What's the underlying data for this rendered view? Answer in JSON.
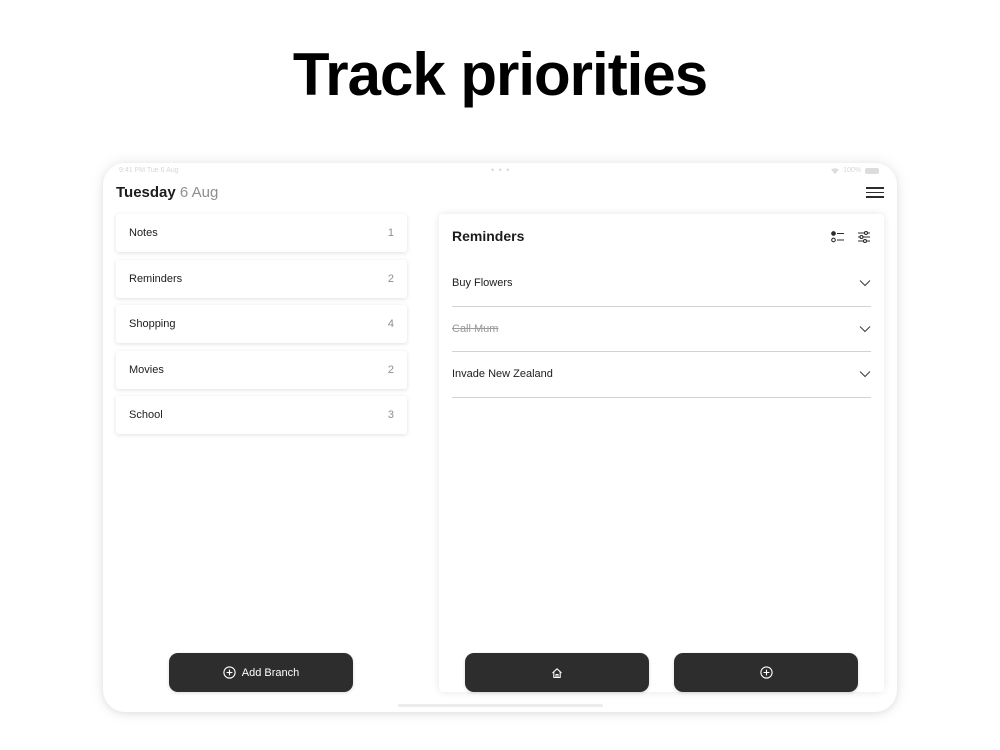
{
  "headline": "Track priorities",
  "status_bar": {
    "time": "9:41 PM  Tue 6 Aug",
    "dots": "• • •",
    "battery": "100%"
  },
  "header": {
    "day": "Tuesday",
    "date": "6 Aug"
  },
  "branches": [
    {
      "name": "Notes",
      "count": "1"
    },
    {
      "name": "Reminders",
      "count": "2"
    },
    {
      "name": "Shopping",
      "count": "4"
    },
    {
      "name": "Movies",
      "count": "2"
    },
    {
      "name": "School",
      "count": "3"
    }
  ],
  "add_branch_label": "Add Branch",
  "panel": {
    "title": "Reminders",
    "reminders": [
      {
        "text": "Buy Flowers",
        "done": false
      },
      {
        "text": "Call Mum",
        "done": true
      },
      {
        "text": "Invade New Zealand",
        "done": false
      }
    ]
  },
  "icons": {
    "menu": "hamburger-menu-icon",
    "list": "checklist-icon",
    "filter": "sliders-icon",
    "chevron": "chevron-down-icon",
    "home": "home-icon",
    "plus": "plus-circle-icon"
  },
  "colors": {
    "button_dark": "#2d2d2d",
    "divider": "#d1d1d6",
    "muted_text": "#8e8e93"
  }
}
